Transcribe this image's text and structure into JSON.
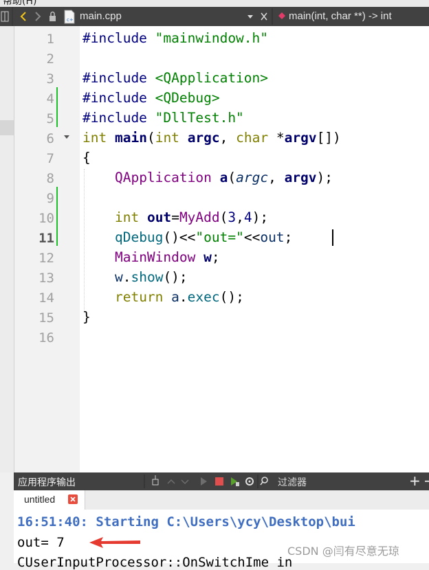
{
  "menu": {
    "partial_label": "帮助(H)"
  },
  "editor_toolbar": {
    "file_name": "main.cpp",
    "symbol": "main(int, char **) -> int",
    "icons": [
      "back-arrow-icon",
      "forward-arrow-icon",
      "lock-icon",
      "cpp-file-icon",
      "dropdown-icon",
      "close-icon",
      "function-symbol-icon"
    ]
  },
  "line_numbers": [
    "1",
    "2",
    "3",
    "4",
    "5",
    "6",
    "7",
    "8",
    "9",
    "10",
    "11",
    "12",
    "13",
    "14",
    "15",
    "16"
  ],
  "current_line": "11",
  "code_lines": [
    "#include \"mainwindow.h\"",
    "",
    "#include <QApplication>",
    "#include <QDebug>",
    "#include \"DllTest.h\"",
    "int main(int argc, char *argv[])",
    "{",
    "    QApplication a(argc, argv);",
    "",
    "    int out=MyAdd(3,4);",
    "    qDebug()<<\"out=\"<<out;",
    "    MainWindow w;",
    "    w.show();",
    "    return a.exec();",
    "}",
    ""
  ],
  "output_pane": {
    "title": "应用程序输出",
    "filter_placeholder": "过滤器",
    "tab_label": "untitled",
    "lines": [
      "16:51:40: Starting C:\\Users\\ycy\\Desktop\\bui",
      "out= 7",
      "CUserInputProcessor::OnSwitchIme in"
    ],
    "plus_label": "+",
    "minus_label": "−"
  },
  "watermark": "CSDN @闫有尽意无琼",
  "colors": {
    "accent_red": "#e53a30",
    "change_bar": "#21be2b"
  }
}
